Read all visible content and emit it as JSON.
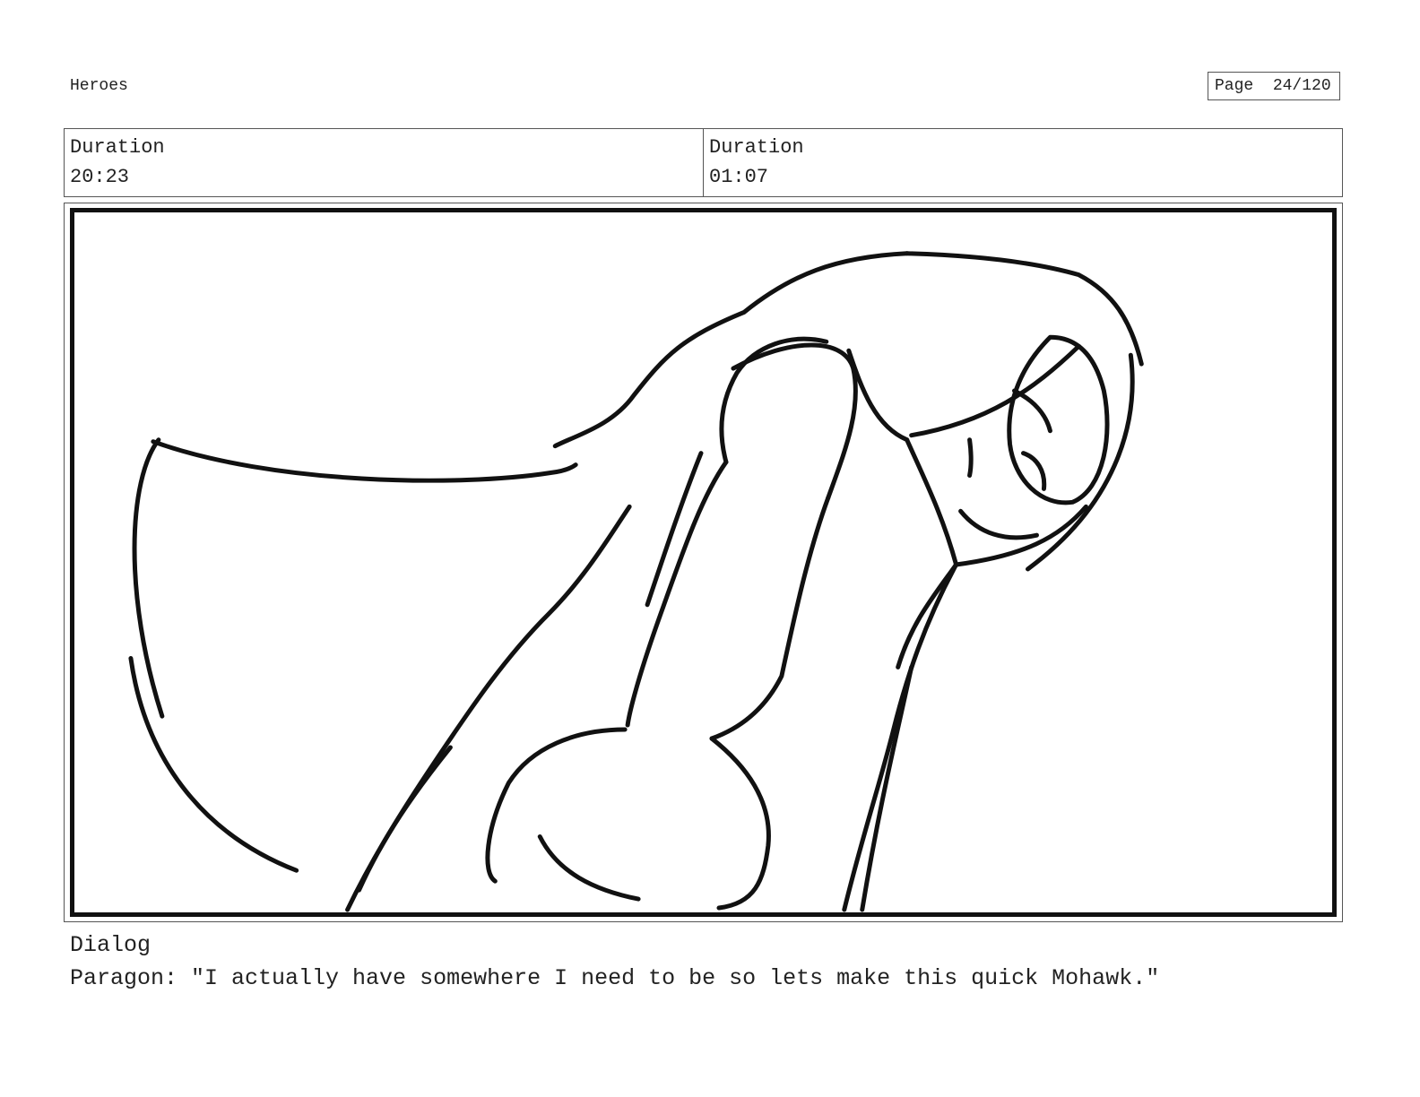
{
  "header": {
    "project_title": "Heroes",
    "page_label": "Page",
    "page_number": "24/120"
  },
  "durations": [
    {
      "label": "Duration",
      "value": "20:23"
    },
    {
      "label": "Duration",
      "value": "01:07"
    }
  ],
  "panel": {
    "subject": "rough sketch of a caped figure leaning forward with a clenched fist"
  },
  "dialog": {
    "label": "Dialog",
    "text": "Paragon: \"I actually have somewhere I need to be so lets make this quick Mohawk.\""
  }
}
